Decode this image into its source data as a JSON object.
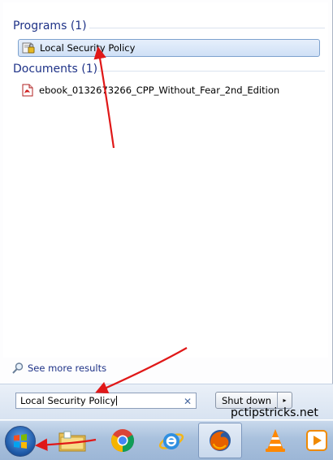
{
  "programs": {
    "header": "Programs (1)",
    "items": [
      {
        "label": "Local Security Policy",
        "icon": "security-policy-icon"
      }
    ]
  },
  "documents": {
    "header": "Documents (1)",
    "items": [
      {
        "label": "ebook_0132673266_CPP_Without_Fear_2nd_Edition",
        "icon": "pdf-icon"
      }
    ]
  },
  "see_more": {
    "label": "See more results",
    "icon": "search-icon"
  },
  "search": {
    "value": "Local Security Policy",
    "clear_icon": "clear-icon"
  },
  "shutdown": {
    "label": "Shut down",
    "arrow": "▸"
  },
  "watermark": "pctipstricks.net",
  "taskbar": {
    "items": [
      {
        "name": "start-button",
        "icon": "windows-orb-icon"
      },
      {
        "name": "explorer-taskbar-button",
        "icon": "folder-icon"
      },
      {
        "name": "chrome-taskbar-button",
        "icon": "chrome-icon"
      },
      {
        "name": "ie-taskbar-button",
        "icon": "ie-icon"
      },
      {
        "name": "firefox-taskbar-button",
        "icon": "firefox-icon"
      },
      {
        "name": "vlc-taskbar-button",
        "icon": "vlc-icon"
      },
      {
        "name": "media-player-taskbar-button",
        "icon": "media-player-icon"
      }
    ]
  },
  "colors": {
    "header_blue": "#1e3287",
    "selection_border": "#7da2ce",
    "annotation_red": "#e01818"
  }
}
